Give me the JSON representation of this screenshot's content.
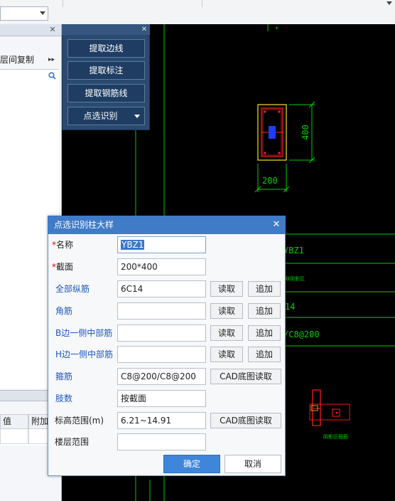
{
  "toolbar": {
    "combo_value": ""
  },
  "left_panel": {
    "copy_label": "层间复制",
    "bottom_headers": [
      "值",
      "附加"
    ]
  },
  "tool_panel": {
    "buttons": [
      "提取边线",
      "提取标注",
      "提取钢筋线",
      "点选识别"
    ]
  },
  "cad": {
    "texts": {
      "dim_width": "200",
      "dim_height": "400",
      "ybz": "YBZ1",
      "note_small": "非阴影区",
      "stirrup_14": "14",
      "stirrup_text": "/C8@200",
      "section_caption": "阴影区箍筋"
    }
  },
  "dialog": {
    "title": "点选识别柱大样",
    "rows": [
      {
        "label": "名称",
        "required": true,
        "value": "YBZ1",
        "style": "dark"
      },
      {
        "label": "截面",
        "required": true,
        "value": "200*400",
        "style": "dark"
      },
      {
        "label": "全部纵筋",
        "required": false,
        "value": "6C14",
        "style": "blue",
        "read": "读取",
        "append": "追加"
      },
      {
        "label": "角筋",
        "required": false,
        "value": "",
        "style": "blue",
        "read": "读取",
        "append": "追加"
      },
      {
        "label": "B边一侧中部筋",
        "required": false,
        "value": "",
        "style": "blue",
        "read": "读取",
        "append": "追加"
      },
      {
        "label": "H边一侧中部筋",
        "required": false,
        "value": "",
        "style": "blue",
        "read": "读取",
        "append": "追加"
      },
      {
        "label": "箍筋",
        "required": false,
        "value": "C8@200/C8@200",
        "style": "blue",
        "cad_read": "CAD底图读取"
      },
      {
        "label": "肢数",
        "required": false,
        "value": "按截面",
        "style": "blue"
      },
      {
        "label": "标高范围(m)",
        "required": false,
        "value": "6.21~14.91",
        "style": "dark",
        "cad_read": "CAD底图读取"
      },
      {
        "label": "楼层范围",
        "required": false,
        "value": "",
        "style": "dark"
      }
    ],
    "ok": "确定",
    "cancel": "取消"
  },
  "colors": {
    "cad_green": "#00d000",
    "rebar_red": "#ff2020",
    "column_yellow": "#e8d020",
    "dialog_accent": "#3f7bc7",
    "label_blue": "#1d56c2"
  }
}
